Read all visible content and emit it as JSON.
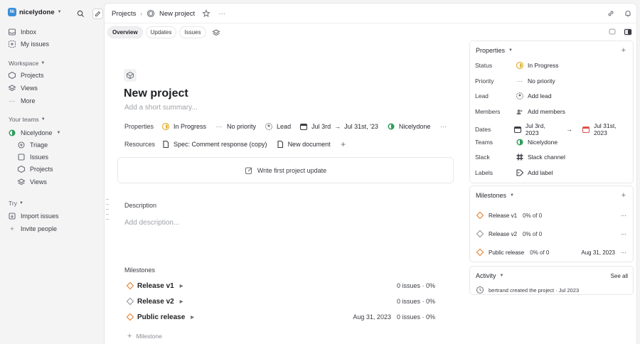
{
  "sidebar": {
    "workspace_initials": "Ni",
    "workspace_name": "nicelydone",
    "inbox": "Inbox",
    "my_issues": "My issues",
    "workspace_section": "Workspace",
    "projects": "Projects",
    "views": "Views",
    "more": "More",
    "teams_section": "Your teams",
    "team_name": "Nicelydone",
    "team_items": [
      "Triage",
      "Issues",
      "Projects",
      "Views"
    ],
    "try_section": "Try",
    "import_issues": "Import issues",
    "invite_people": "Invite people"
  },
  "header": {
    "crumb_projects": "Projects",
    "crumb_project": "New project"
  },
  "tabs": [
    "Overview",
    "Updates",
    "Issues"
  ],
  "project": {
    "title": "New project",
    "summary_placeholder": "Add a short summary...",
    "properties_label": "Properties",
    "status": "In Progress",
    "priority": "No priority",
    "lead": "Lead",
    "start": "Jul 3rd",
    "end": "Jul 31st, '23",
    "team": "Nicelydone",
    "resources_label": "Resources",
    "resource_1": "Spec: Comment response (copy)",
    "resource_2": "New document",
    "write_update": "Write first project update",
    "description_heading": "Description",
    "description_placeholder": "Add description...",
    "milestones_heading": "Milestones",
    "milestones": [
      {
        "name": "Release v1",
        "date": "",
        "stats": "0 issues · 0%"
      },
      {
        "name": "Release v2",
        "date": "",
        "stats": "0 issues · 0%"
      },
      {
        "name": "Public release",
        "date": "Aug 31, 2023",
        "stats": "0 issues · 0%"
      }
    ],
    "add_milestone": "Milestone"
  },
  "properties_panel": {
    "heading": "Properties",
    "rows": {
      "status_k": "Status",
      "status_v": "In Progress",
      "priority_k": "Priority",
      "priority_v": "No priority",
      "lead_k": "Lead",
      "lead_v": "Add lead",
      "members_k": "Members",
      "members_v": "Add members",
      "dates_k": "Dates",
      "start_v": "Jul 3rd, 2023",
      "end_v": "Jul 31st, 2023",
      "teams_k": "Teams",
      "teams_v": "Nicelydone",
      "slack_k": "Slack",
      "slack_v": "Slack channel",
      "labels_k": "Labels",
      "labels_v": "Add label"
    }
  },
  "milestones_panel": {
    "heading": "Milestones",
    "items": [
      {
        "name": "Release v1",
        "pct": "0% of 0",
        "date": ""
      },
      {
        "name": "Release v2",
        "pct": "0% of 0",
        "date": ""
      },
      {
        "name": "Public release",
        "pct": "0% of 0",
        "date": "Aug 31, 2023"
      }
    ]
  },
  "activity_panel": {
    "heading": "Activity",
    "see_all": "See all",
    "entry": "bertrand created the project · Jul 2023"
  },
  "colors": {
    "in_progress": "#e2b53c",
    "milestone_orange": "#e8873c",
    "team_green": "#2e9e5b",
    "date_red": "#d9534f"
  }
}
